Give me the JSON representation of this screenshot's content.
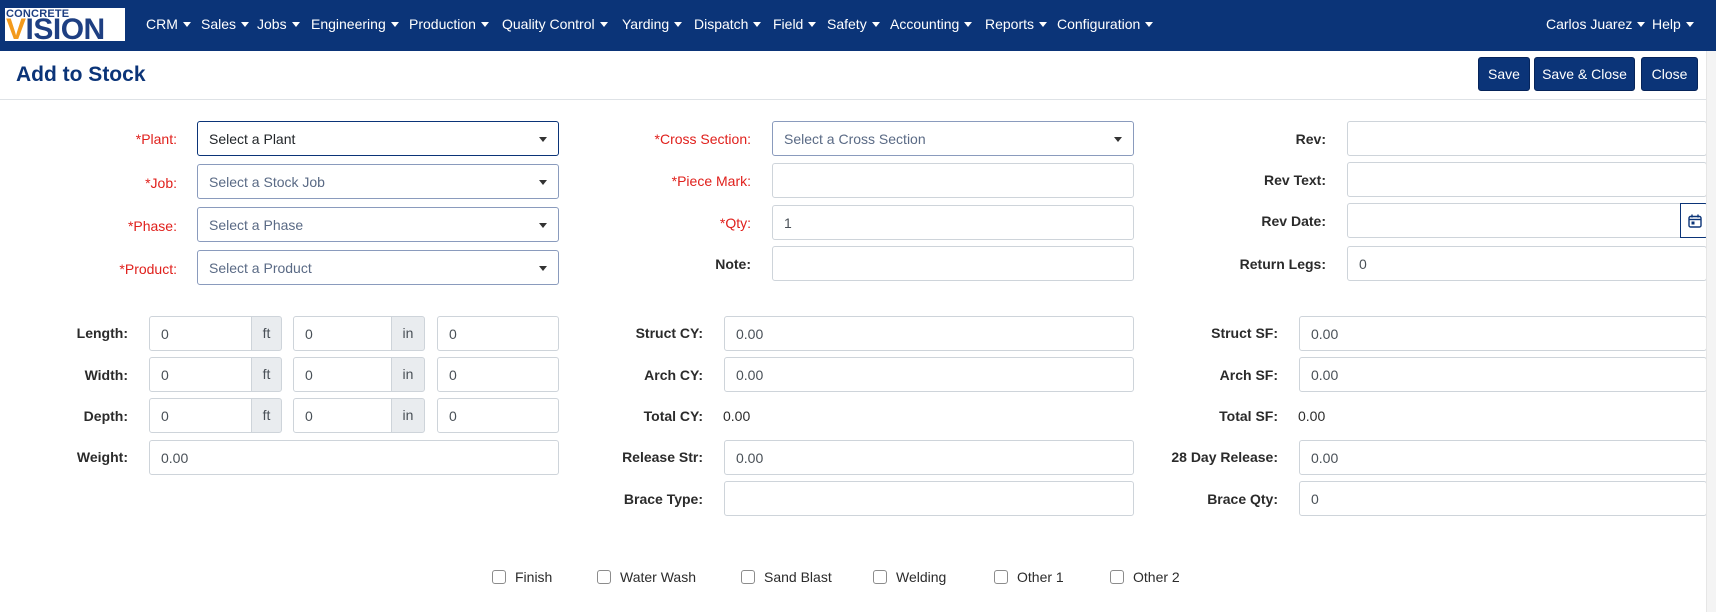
{
  "brand": {
    "top": "CONCRETE",
    "bottom_prefix": "V",
    "bottom_rest": "ISION"
  },
  "nav": {
    "items": [
      "CRM",
      "Sales",
      "Jobs",
      "Engineering",
      "Production",
      "Quality Control",
      "Yarding",
      "Dispatch",
      "Field",
      "Safety",
      "Accounting",
      "Reports",
      "Configuration"
    ],
    "user": "Carlos Juarez",
    "help": "Help"
  },
  "page": {
    "title": "Add to Stock"
  },
  "toolbar": {
    "save": "Save",
    "save_close": "Save & Close",
    "close": "Close"
  },
  "form": {
    "plant": {
      "label": "*Plant:",
      "value": "Select a Plant"
    },
    "job": {
      "label": "*Job:",
      "placeholder": "Select a Stock Job"
    },
    "phase": {
      "label": "*Phase:",
      "placeholder": "Select a Phase"
    },
    "product": {
      "label": "*Product:",
      "placeholder": "Select a Product"
    },
    "cross_section": {
      "label": "*Cross Section:",
      "placeholder": "Select a Cross Section"
    },
    "piece_mark": {
      "label": "*Piece Mark:",
      "value": ""
    },
    "qty": {
      "label": "*Qty:",
      "value": "1"
    },
    "note": {
      "label": "Note:",
      "value": ""
    },
    "rev": {
      "label": "Rev:",
      "value": ""
    },
    "rev_text": {
      "label": "Rev Text:",
      "value": ""
    },
    "rev_date": {
      "label": "Rev Date:",
      "value": ""
    },
    "return_legs": {
      "label": "Return Legs:",
      "value": "0"
    },
    "unit_ft": "ft",
    "unit_in": "in",
    "length": {
      "label": "Length:",
      "ft": "0",
      "in": "0",
      "total": "0"
    },
    "width": {
      "label": "Width:",
      "ft": "0",
      "in": "0",
      "total": "0"
    },
    "depth": {
      "label": "Depth:",
      "ft": "0",
      "in": "0",
      "total": "0"
    },
    "weight": {
      "label": "Weight:",
      "value": "0.00"
    },
    "struct_cy": {
      "label": "Struct CY:",
      "value": "0.00"
    },
    "arch_cy": {
      "label": "Arch CY:",
      "value": "0.00"
    },
    "total_cy": {
      "label": "Total CY:",
      "value": "0.00"
    },
    "release_str": {
      "label": "Release Str:",
      "value": "0.00"
    },
    "brace_type": {
      "label": "Brace Type:",
      "value": ""
    },
    "struct_sf": {
      "label": "Struct SF:",
      "value": "0.00"
    },
    "arch_sf": {
      "label": "Arch SF:",
      "value": "0.00"
    },
    "total_sf": {
      "label": "Total SF:",
      "value": "0.00"
    },
    "day28_release": {
      "label": "28 Day Release:",
      "value": "0.00"
    },
    "brace_qty": {
      "label": "Brace Qty:",
      "value": "0"
    }
  },
  "finishes": [
    "Finish",
    "Water Wash",
    "Sand Blast",
    "Welding",
    "Other 1",
    "Other 2"
  ],
  "icons": {
    "calendar": "calendar-icon",
    "caret": "caret-down-icon"
  },
  "colors": {
    "navbar": "#0b3478",
    "required": "#e0201c",
    "accent": "#f39a1c"
  }
}
